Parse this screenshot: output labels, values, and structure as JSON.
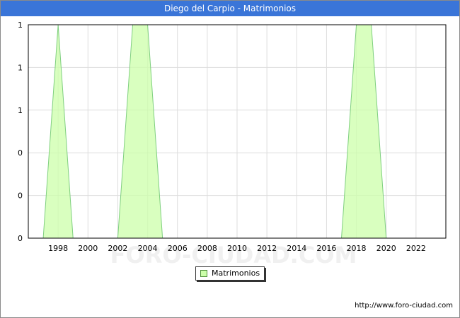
{
  "title": "Diego del Carpio - Matrimonios",
  "source": "http://www.foro-ciudad.com",
  "watermark": "FORO-CIUDAD.COM",
  "colors": {
    "header": "#3a75d8",
    "fill": "#ccffaa",
    "line": "#7fcf7f",
    "grid": "#dddddd"
  },
  "chart_data": {
    "type": "area",
    "title": "Diego del Carpio - Matrimonios",
    "xlabel": "",
    "ylabel": "",
    "xlim": [
      1996,
      2024
    ],
    "ylim": [
      0,
      1
    ],
    "x_ticks": [
      1998,
      2000,
      2002,
      2004,
      2006,
      2008,
      2010,
      2012,
      2014,
      2016,
      2018,
      2020,
      2022
    ],
    "y_tick_labels": [
      "0",
      "0",
      "0",
      "1",
      "1",
      "1"
    ],
    "grid": true,
    "legend_position": "bottom-center",
    "series": [
      {
        "name": "Matrimonios",
        "x": [
          1997,
          1998,
          1999,
          2002,
          2003,
          2004,
          2005,
          2017,
          2018,
          2019,
          2020
        ],
        "values": [
          0,
          1,
          0,
          0,
          1,
          1,
          0,
          0,
          1,
          1,
          0
        ]
      }
    ]
  }
}
